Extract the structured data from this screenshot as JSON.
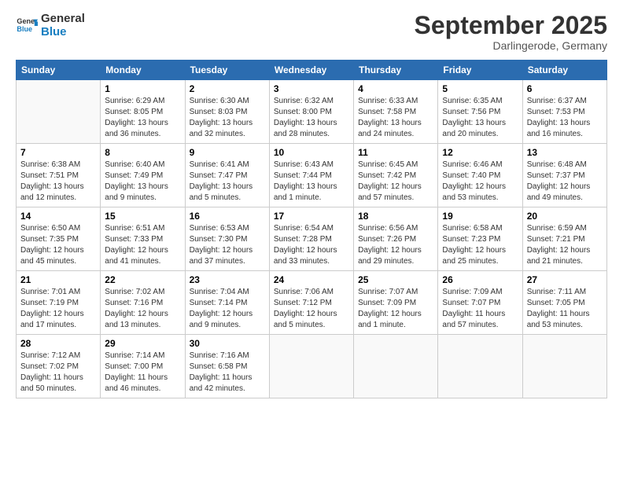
{
  "logo": {
    "line1": "General",
    "line2": "Blue"
  },
  "title": "September 2025",
  "location": "Darlingerode, Germany",
  "headers": [
    "Sunday",
    "Monday",
    "Tuesday",
    "Wednesday",
    "Thursday",
    "Friday",
    "Saturday"
  ],
  "weeks": [
    [
      {
        "day": "",
        "info": ""
      },
      {
        "day": "1",
        "info": "Sunrise: 6:29 AM\nSunset: 8:05 PM\nDaylight: 13 hours\nand 36 minutes."
      },
      {
        "day": "2",
        "info": "Sunrise: 6:30 AM\nSunset: 8:03 PM\nDaylight: 13 hours\nand 32 minutes."
      },
      {
        "day": "3",
        "info": "Sunrise: 6:32 AM\nSunset: 8:00 PM\nDaylight: 13 hours\nand 28 minutes."
      },
      {
        "day": "4",
        "info": "Sunrise: 6:33 AM\nSunset: 7:58 PM\nDaylight: 13 hours\nand 24 minutes."
      },
      {
        "day": "5",
        "info": "Sunrise: 6:35 AM\nSunset: 7:56 PM\nDaylight: 13 hours\nand 20 minutes."
      },
      {
        "day": "6",
        "info": "Sunrise: 6:37 AM\nSunset: 7:53 PM\nDaylight: 13 hours\nand 16 minutes."
      }
    ],
    [
      {
        "day": "7",
        "info": "Sunrise: 6:38 AM\nSunset: 7:51 PM\nDaylight: 13 hours\nand 12 minutes."
      },
      {
        "day": "8",
        "info": "Sunrise: 6:40 AM\nSunset: 7:49 PM\nDaylight: 13 hours\nand 9 minutes."
      },
      {
        "day": "9",
        "info": "Sunrise: 6:41 AM\nSunset: 7:47 PM\nDaylight: 13 hours\nand 5 minutes."
      },
      {
        "day": "10",
        "info": "Sunrise: 6:43 AM\nSunset: 7:44 PM\nDaylight: 13 hours\nand 1 minute."
      },
      {
        "day": "11",
        "info": "Sunrise: 6:45 AM\nSunset: 7:42 PM\nDaylight: 12 hours\nand 57 minutes."
      },
      {
        "day": "12",
        "info": "Sunrise: 6:46 AM\nSunset: 7:40 PM\nDaylight: 12 hours\nand 53 minutes."
      },
      {
        "day": "13",
        "info": "Sunrise: 6:48 AM\nSunset: 7:37 PM\nDaylight: 12 hours\nand 49 minutes."
      }
    ],
    [
      {
        "day": "14",
        "info": "Sunrise: 6:50 AM\nSunset: 7:35 PM\nDaylight: 12 hours\nand 45 minutes."
      },
      {
        "day": "15",
        "info": "Sunrise: 6:51 AM\nSunset: 7:33 PM\nDaylight: 12 hours\nand 41 minutes."
      },
      {
        "day": "16",
        "info": "Sunrise: 6:53 AM\nSunset: 7:30 PM\nDaylight: 12 hours\nand 37 minutes."
      },
      {
        "day": "17",
        "info": "Sunrise: 6:54 AM\nSunset: 7:28 PM\nDaylight: 12 hours\nand 33 minutes."
      },
      {
        "day": "18",
        "info": "Sunrise: 6:56 AM\nSunset: 7:26 PM\nDaylight: 12 hours\nand 29 minutes."
      },
      {
        "day": "19",
        "info": "Sunrise: 6:58 AM\nSunset: 7:23 PM\nDaylight: 12 hours\nand 25 minutes."
      },
      {
        "day": "20",
        "info": "Sunrise: 6:59 AM\nSunset: 7:21 PM\nDaylight: 12 hours\nand 21 minutes."
      }
    ],
    [
      {
        "day": "21",
        "info": "Sunrise: 7:01 AM\nSunset: 7:19 PM\nDaylight: 12 hours\nand 17 minutes."
      },
      {
        "day": "22",
        "info": "Sunrise: 7:02 AM\nSunset: 7:16 PM\nDaylight: 12 hours\nand 13 minutes."
      },
      {
        "day": "23",
        "info": "Sunrise: 7:04 AM\nSunset: 7:14 PM\nDaylight: 12 hours\nand 9 minutes."
      },
      {
        "day": "24",
        "info": "Sunrise: 7:06 AM\nSunset: 7:12 PM\nDaylight: 12 hours\nand 5 minutes."
      },
      {
        "day": "25",
        "info": "Sunrise: 7:07 AM\nSunset: 7:09 PM\nDaylight: 12 hours\nand 1 minute."
      },
      {
        "day": "26",
        "info": "Sunrise: 7:09 AM\nSunset: 7:07 PM\nDaylight: 11 hours\nand 57 minutes."
      },
      {
        "day": "27",
        "info": "Sunrise: 7:11 AM\nSunset: 7:05 PM\nDaylight: 11 hours\nand 53 minutes."
      }
    ],
    [
      {
        "day": "28",
        "info": "Sunrise: 7:12 AM\nSunset: 7:02 PM\nDaylight: 11 hours\nand 50 minutes."
      },
      {
        "day": "29",
        "info": "Sunrise: 7:14 AM\nSunset: 7:00 PM\nDaylight: 11 hours\nand 46 minutes."
      },
      {
        "day": "30",
        "info": "Sunrise: 7:16 AM\nSunset: 6:58 PM\nDaylight: 11 hours\nand 42 minutes."
      },
      {
        "day": "",
        "info": ""
      },
      {
        "day": "",
        "info": ""
      },
      {
        "day": "",
        "info": ""
      },
      {
        "day": "",
        "info": ""
      }
    ]
  ]
}
